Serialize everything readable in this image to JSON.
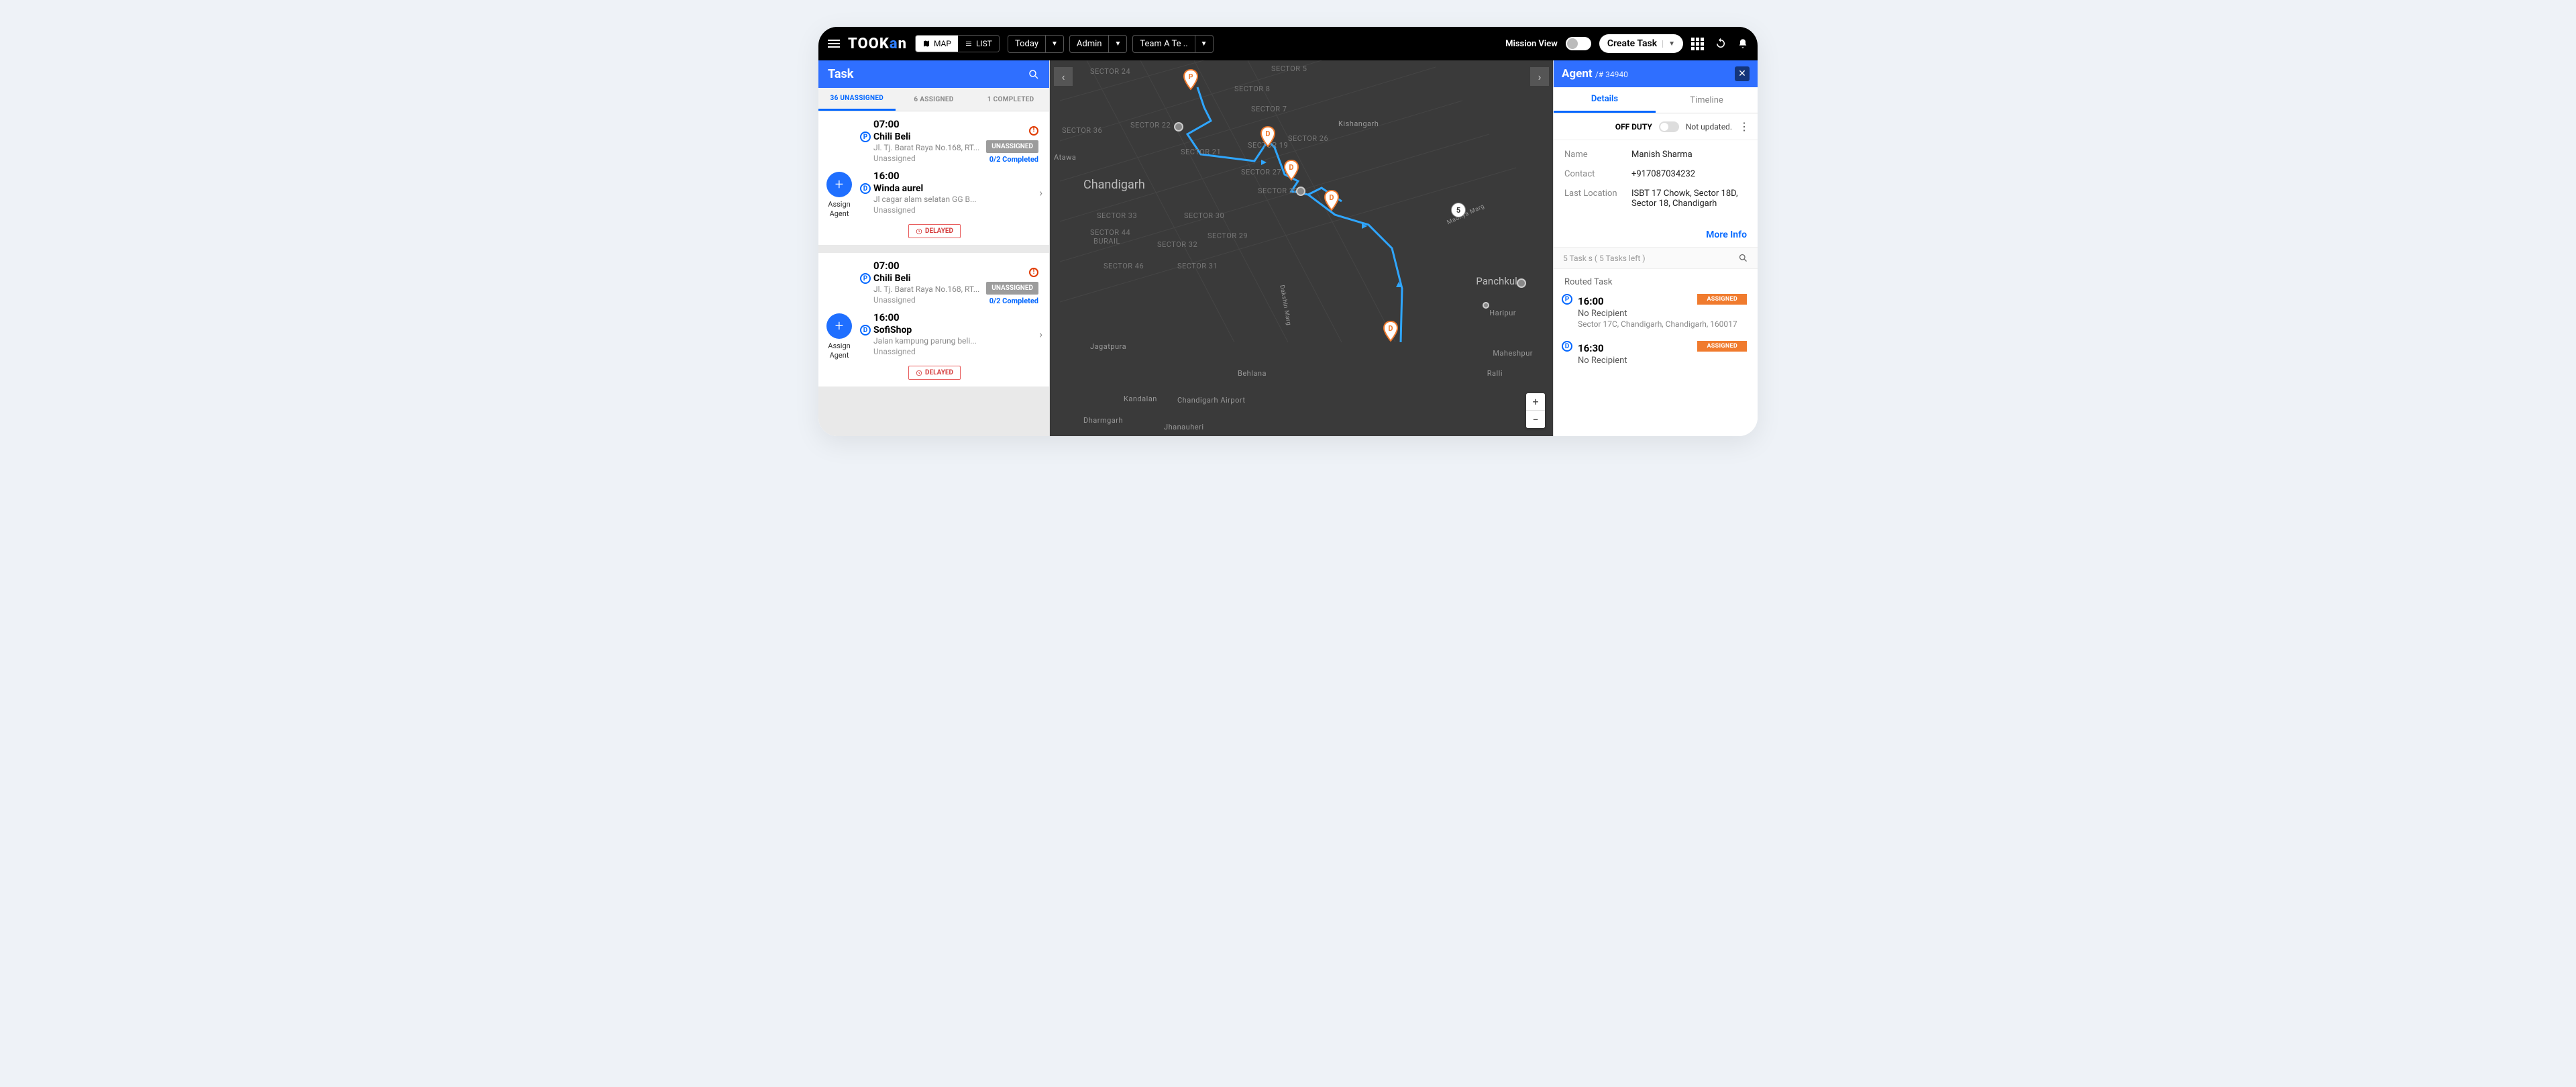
{
  "topbar": {
    "logo": "TOOKAN",
    "view_toggle": {
      "map": "MAP",
      "list": "LIST"
    },
    "dropdowns": {
      "date": "Today",
      "role": "Admin",
      "team": "Team A Te .."
    },
    "mission_view": "Mission View",
    "create_task": "Create Task"
  },
  "left": {
    "title": "Task",
    "tabs": {
      "unassigned": "36 UNASSIGNED",
      "assigned": "6 ASSIGNED",
      "completed": "1 COMPLETED"
    },
    "assign_btn": "Assign Agent",
    "badges": {
      "unassigned": "UNASSIGNED",
      "completed": "0/2 Completed",
      "delayed": "DELAYED",
      "unassigned_text": "Unassigned"
    },
    "cards": [
      {
        "p": {
          "time": "07:00",
          "title": "Chili Beli",
          "addr": "Jl. Tj. Barat Raya No.168, RT..."
        },
        "d": {
          "time": "16:00",
          "title": "Winda aurel",
          "addr": "Jl cagar alam selatan GG B..."
        }
      },
      {
        "p": {
          "time": "07:00",
          "title": "Chili Beli",
          "addr": "Jl. Tj. Barat Raya No.168, RT..."
        },
        "d": {
          "time": "16:00",
          "title": "SofiShop",
          "addr": "Jalan kampung parung beli..."
        }
      }
    ]
  },
  "map": {
    "count_badge": "5",
    "cities": [
      "Chandigarh",
      "Panchkula"
    ],
    "sectors": [
      "SECTOR 24",
      "SECTOR 5",
      "SECTOR 8",
      "SECTOR 7",
      "SECTOR 22",
      "SECTOR 36",
      "SECTOR 26",
      "SECTOR 21",
      "SECTOR 19",
      "SECTOR 27",
      "SECTOR 28",
      "SECTOR 33",
      "SECTOR 30",
      "SECTOR 44",
      "SECTOR 29",
      "SECTOR 32",
      "SECTOR 46",
      "SECTOR 31",
      "BURAIL"
    ],
    "places": [
      "Kishangarh",
      "Atawa",
      "Madhya Marg",
      "Haripur",
      "Maheshpur",
      "Ralli",
      "Jagatpura",
      "Behlana",
      "Kandalan",
      "Chandigarh Airport",
      "Dharmgarh",
      "Jhanauheri",
      "Dakshin Marg"
    ]
  },
  "right": {
    "title": "Agent",
    "sub": "/# 34940",
    "tabs": {
      "details": "Details",
      "timeline": "Timeline"
    },
    "duty": {
      "off": "OFF DUTY",
      "status": "Not updated."
    },
    "info": {
      "name_k": "Name",
      "name_v": "Manish Sharma",
      "contact_k": "Contact",
      "contact_v": "+917087034232",
      "loc_k": "Last Location",
      "loc_v": "ISBT 17 Chowk, Sector 18D, Sector 18, Chandigarh"
    },
    "more_info": "More Info",
    "search_placeholder": "5 Task s ( 5 Tasks left )",
    "routed_h": "Routed Task",
    "assigned": "ASSIGNED",
    "routed": [
      {
        "badge": "P",
        "time": "16:00",
        "title": "No Recipient",
        "addr": "Sector 17C, Chandigarh, Chandigarh, 160017"
      },
      {
        "badge": "D",
        "time": "16:30",
        "title": "No Recipient",
        "addr": ""
      }
    ]
  }
}
